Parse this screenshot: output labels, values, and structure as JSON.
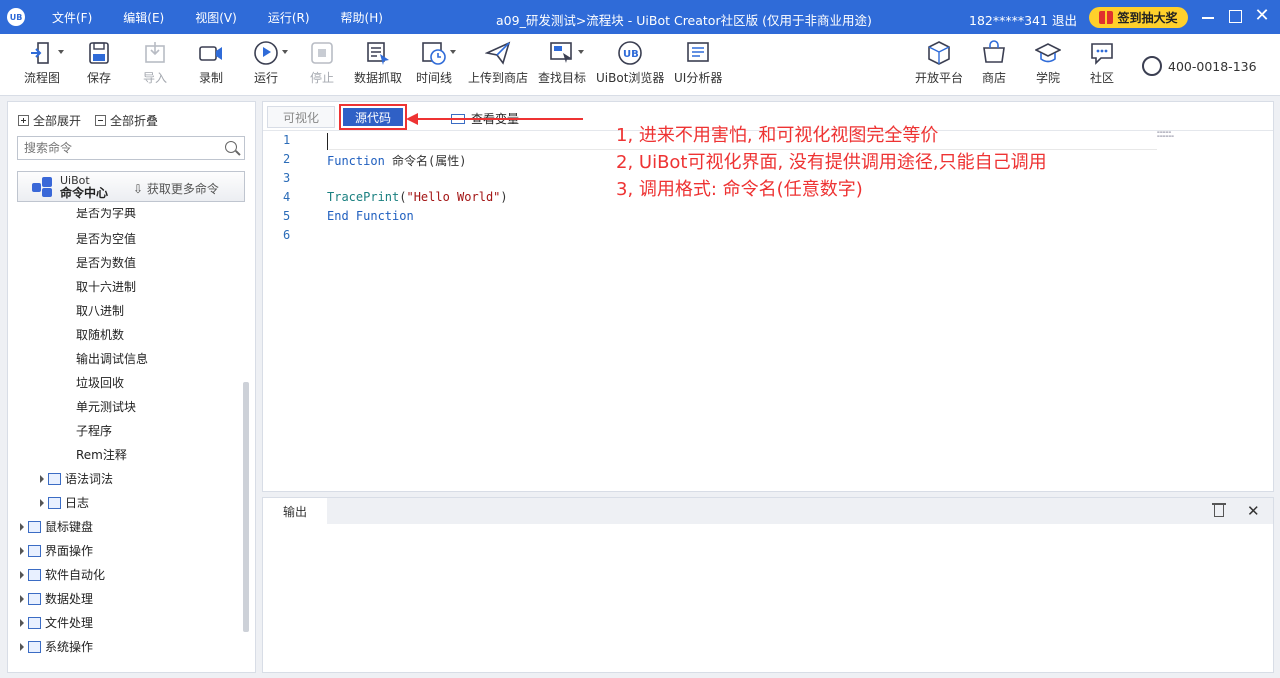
{
  "app": {
    "logo": "UB",
    "menus": [
      "文件(F)",
      "编辑(E)",
      "视图(V)",
      "运行(R)",
      "帮助(H)"
    ],
    "title": "a09_研发测试>流程块 - UiBot Creator社区版 (仅用于非商业用途)",
    "user": "182*****341 退出",
    "gift_label": "签到抽大奖"
  },
  "toolbar": {
    "flowchart": "流程图",
    "save": "保存",
    "import": "导入",
    "record": "录制",
    "run": "运行",
    "stop": "停止",
    "data_capture": "数据抓取",
    "timeline": "时间线",
    "upload_store": "上传到商店",
    "find_target": "查找目标",
    "browser": "UiBot浏览器",
    "ui_analyzer": "UI分析器",
    "open_platform": "开放平台",
    "store": "商店",
    "academy": "学院",
    "community": "社区",
    "phone": "400-0018-136"
  },
  "left": {
    "expand_all": "全部展开",
    "collapse_all": "全部折叠",
    "search_placeholder": "搜索命令",
    "cmd_center_a": "UiBot",
    "cmd_center_b": "命令中心",
    "get_more": "获取更多命令",
    "tree": {
      "partial": "是否为字典",
      "items": [
        "是否为空值",
        "是否为数值",
        "取十六进制",
        "取八进制",
        "取随机数",
        "输出调试信息",
        "垃圾回收",
        "单元测试块",
        "子程序",
        "Rem注释"
      ],
      "sub_groups": [
        "语法词法",
        "日志"
      ],
      "groups": [
        "鼠标键盘",
        "界面操作",
        "软件自动化",
        "数据处理",
        "文件处理",
        "系统操作"
      ]
    }
  },
  "editor": {
    "tab_visual": "可视化",
    "tab_source": "源代码",
    "tab_vars": "查看变量",
    "line_numbers": [
      "1",
      "2",
      "3",
      "4",
      "5",
      "6"
    ],
    "code": {
      "l2_kw": "Function",
      "l2_rest": " 命令名(属性)",
      "l4_fn": "TracePrint",
      "l4_open": "(",
      "l4_str": "\"Hello World\"",
      "l4_close": ")",
      "l5": "End Function"
    },
    "annotations": [
      "1, 进来不用害怕, 和可视化视图完全等价",
      "2, UiBot可视化界面, 没有提供调用途径,只能自己调用",
      "3, 调用格式:   命令名(任意数字)"
    ]
  },
  "output": {
    "tab": "输出"
  },
  "colors": {
    "accent": "#2f6bd8",
    "annotation": "#ee3333",
    "gift": "#ffd02b"
  }
}
